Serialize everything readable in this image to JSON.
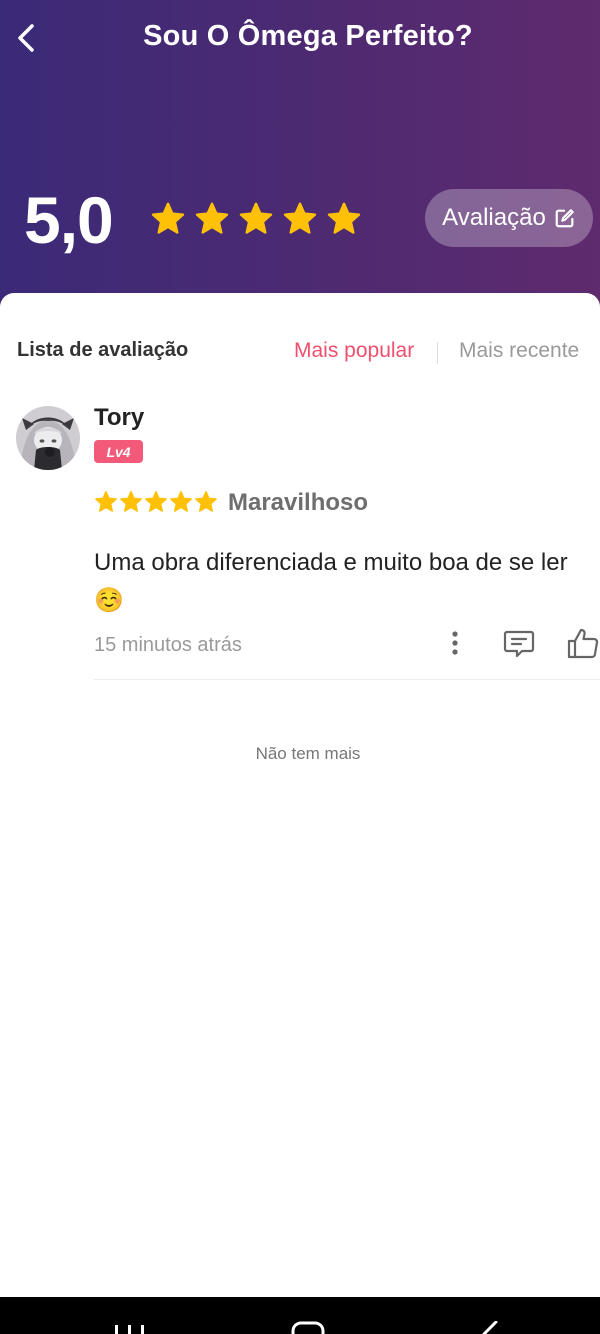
{
  "header": {
    "title": "Sou O Ômega Perfeito?",
    "score": "5,0",
    "stars": 5,
    "rate_button_label": "Avaliação",
    "gradient": [
      "#3b2a78",
      "#5f2a6e"
    ],
    "star_color": "#ffc107"
  },
  "list": {
    "title": "Lista de avaliação",
    "sort_options": [
      "Mais popular",
      "Mais recente"
    ],
    "active_sort": "Mais popular",
    "accent_color": "#f0506e"
  },
  "reviews": [
    {
      "username": "Tory",
      "level": "Lv4",
      "stars": 5,
      "rating_label": "Maravilhoso",
      "text": "Uma obra diferenciada e muito boa de se ler ☺️",
      "time": "15 minutos atrás",
      "icons": [
        "more-icon",
        "comment-icon",
        "thumbs-up-icon"
      ]
    }
  ],
  "footer": {
    "end_text": "Não tem mais"
  }
}
